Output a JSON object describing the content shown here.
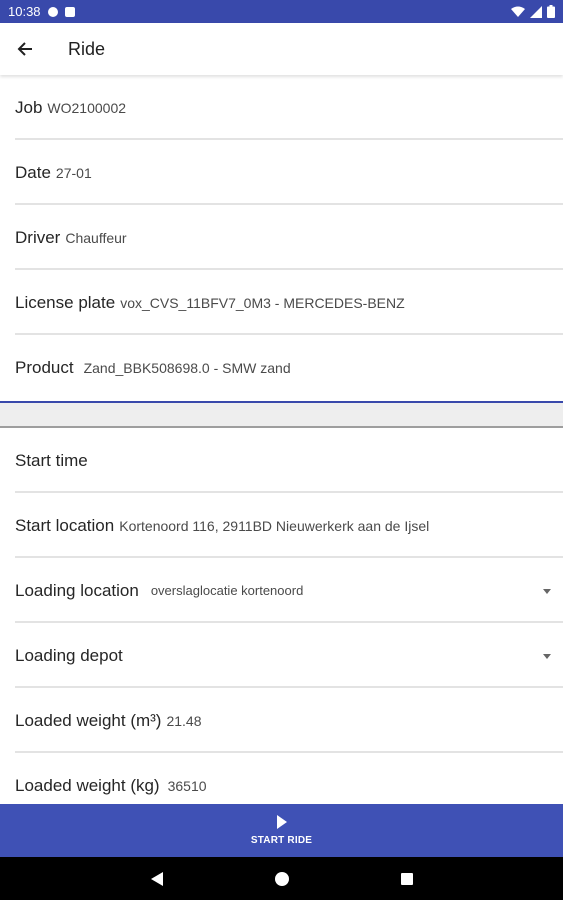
{
  "status_bar": {
    "time": "10:38"
  },
  "app_bar": {
    "title": "Ride"
  },
  "ride_info": [
    {
      "label": "Job",
      "value": "WO2100002"
    },
    {
      "label": "Date",
      "value": "27-01"
    },
    {
      "label": "Driver",
      "value": "Chauffeur"
    },
    {
      "label": "License plate",
      "value": "vox_CVS_11BFV7_0M3 - MERCEDES-BENZ"
    },
    {
      "label": "Product",
      "value": "Zand_BBK508698.0 - SMW zand"
    }
  ],
  "ride_form": {
    "start_time": {
      "label": "Start time"
    },
    "start_location": {
      "label": "Start location",
      "value": "Kortenoord 116, 2911BD Nieuwerkerk aan de Ijsel"
    },
    "loading_location": {
      "label": "Loading location",
      "value": "overslaglocatie kortenoord"
    },
    "loading_depot": {
      "label": "Loading depot",
      "value": ""
    },
    "loaded_weight_m3": {
      "label": "Loaded weight (m³)",
      "value": "21.48"
    },
    "loaded_weight_kg": {
      "label": "Loaded weight (kg)",
      "value": "36510"
    }
  },
  "actions": {
    "start_ride": "START RIDE"
  },
  "colors": {
    "primary": "#3f51b5",
    "status_bar": "#3949ab",
    "divider": "#e3e3e3"
  }
}
